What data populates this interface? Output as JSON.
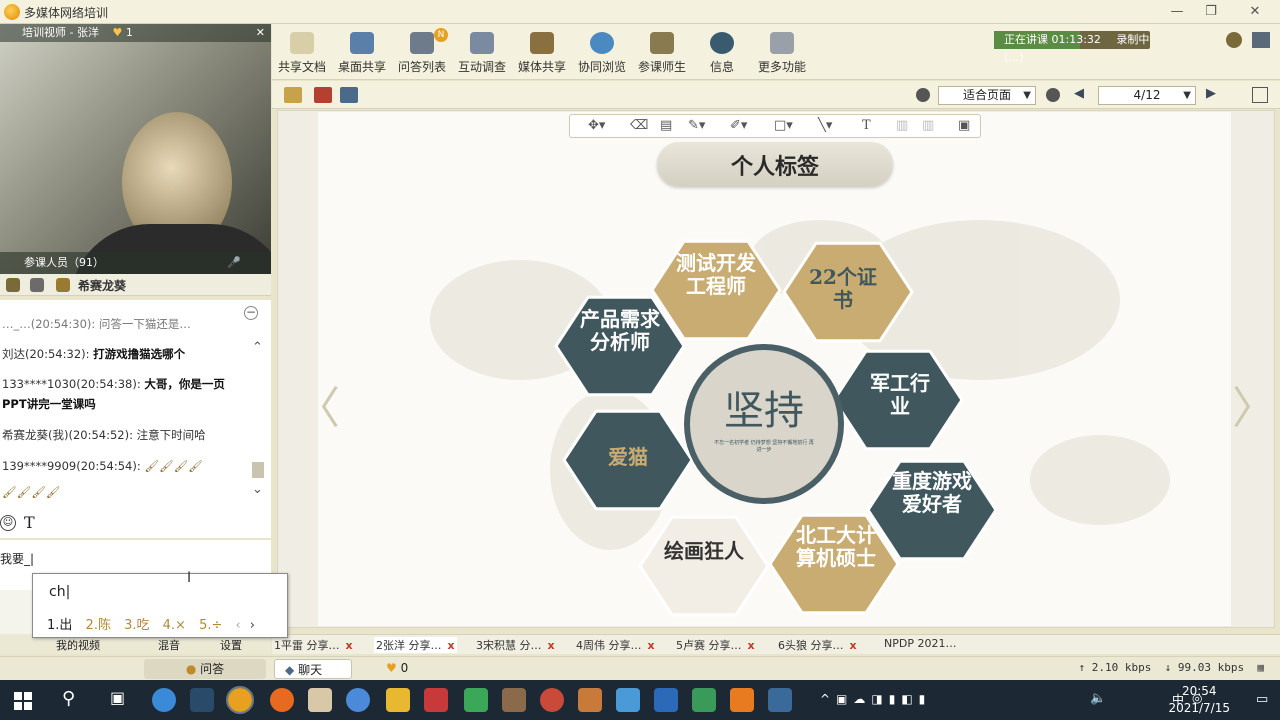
{
  "window": {
    "title": "多媒体网络培训",
    "controls": [
      "—",
      "❐",
      "✕"
    ]
  },
  "video": {
    "title": "培训视师 - 张洋",
    "like_count": "1",
    "participants_label": "参课人员（91）",
    "controls_label": "🎤"
  },
  "participant_bar": {
    "name": "希赛龙葵"
  },
  "chat": {
    "messages": [
      {
        "text": "…_…(20:54:30): 问答一下猫还是…"
      },
      {
        "sender": "刘达(20:54:32):",
        "content": "打游戏撸猫选哪个"
      },
      {
        "sender": "133****1030(20:54:38):",
        "content": "大哥，你是一页"
      },
      {
        "sender": "",
        "content": "PPT讲完一堂课吗"
      },
      {
        "sender": "希赛龙葵(我)(20:54:52):",
        "content": "注意下时间哈"
      },
      {
        "sender": "139****9909(20:54:54):",
        "content": "🖌🖌🖌🖌"
      },
      {
        "sender": "",
        "content": "🖌🖌🖌🖌"
      }
    ],
    "input_text": "我要_|"
  },
  "ime": {
    "typed": "ch|",
    "candidates": [
      "1.出",
      "2.陈",
      "3.吃",
      "4.×",
      "5.÷"
    ]
  },
  "left_bottom_tabs": [
    "我的视频",
    "混音",
    "设置"
  ],
  "toolbar": {
    "buttons": [
      {
        "label": "共享文档",
        "color": "#d8cfa8"
      },
      {
        "label": "桌面共享",
        "color": "#5a7fa8"
      },
      {
        "label": "问答列表",
        "color": "#6e7b8a"
      },
      {
        "label": "互动调查",
        "color": "#7a8aa0"
      },
      {
        "label": "媒体共享",
        "color": "#8a7040"
      },
      {
        "label": "协同浏览",
        "color": "#4a8ac0"
      },
      {
        "label": "参课师生",
        "color": "#8a7a50"
      },
      {
        "label": "信息",
        "color": "#3a5a70"
      },
      {
        "label": "更多功能",
        "color": "#9aa0a8"
      }
    ],
    "badge": "N",
    "timer_text": "正在讲课 01:13:32",
    "timer_right": "录制中 (…)"
  },
  "toolbar2": {
    "zoom_label": "适合页面",
    "page_label": "4/12"
  },
  "slide": {
    "title": "个人标签",
    "center_main": "坚持",
    "center_sub": "不忘一名初学者 仍持梦想 坚持不懈地前行 再进一步",
    "tags": [
      {
        "text": "测试开发工程师"
      },
      {
        "text": "22个证书"
      },
      {
        "text": "产品需求分析师"
      },
      {
        "text": "军工行业"
      },
      {
        "text": "爱猫"
      },
      {
        "text": "重度游戏爱好者"
      },
      {
        "text": "绘画狂人"
      },
      {
        "text": "北工大计算机硕士"
      }
    ]
  },
  "doc_tabs": [
    "1平雷 分享…",
    "2张洋 分享…",
    "3宋积慧 分…",
    "4周伟 分享…",
    "5卢赛 分享…",
    "6头狼 分享…",
    "NPDP 2021…"
  ],
  "status": {
    "qa_tab": "问答",
    "chat_tab": "聊天",
    "like_count": "0",
    "upload": "↑ 2.10 kbps",
    "download": "↓ 99.03 kbps"
  },
  "taskbar": {
    "ime_indicator": "中",
    "time": "20:54",
    "date": "2021/7/15"
  },
  "colors": {
    "slate": "#3f575d",
    "gold": "#c9ac72",
    "pale": "#f2eee6"
  }
}
